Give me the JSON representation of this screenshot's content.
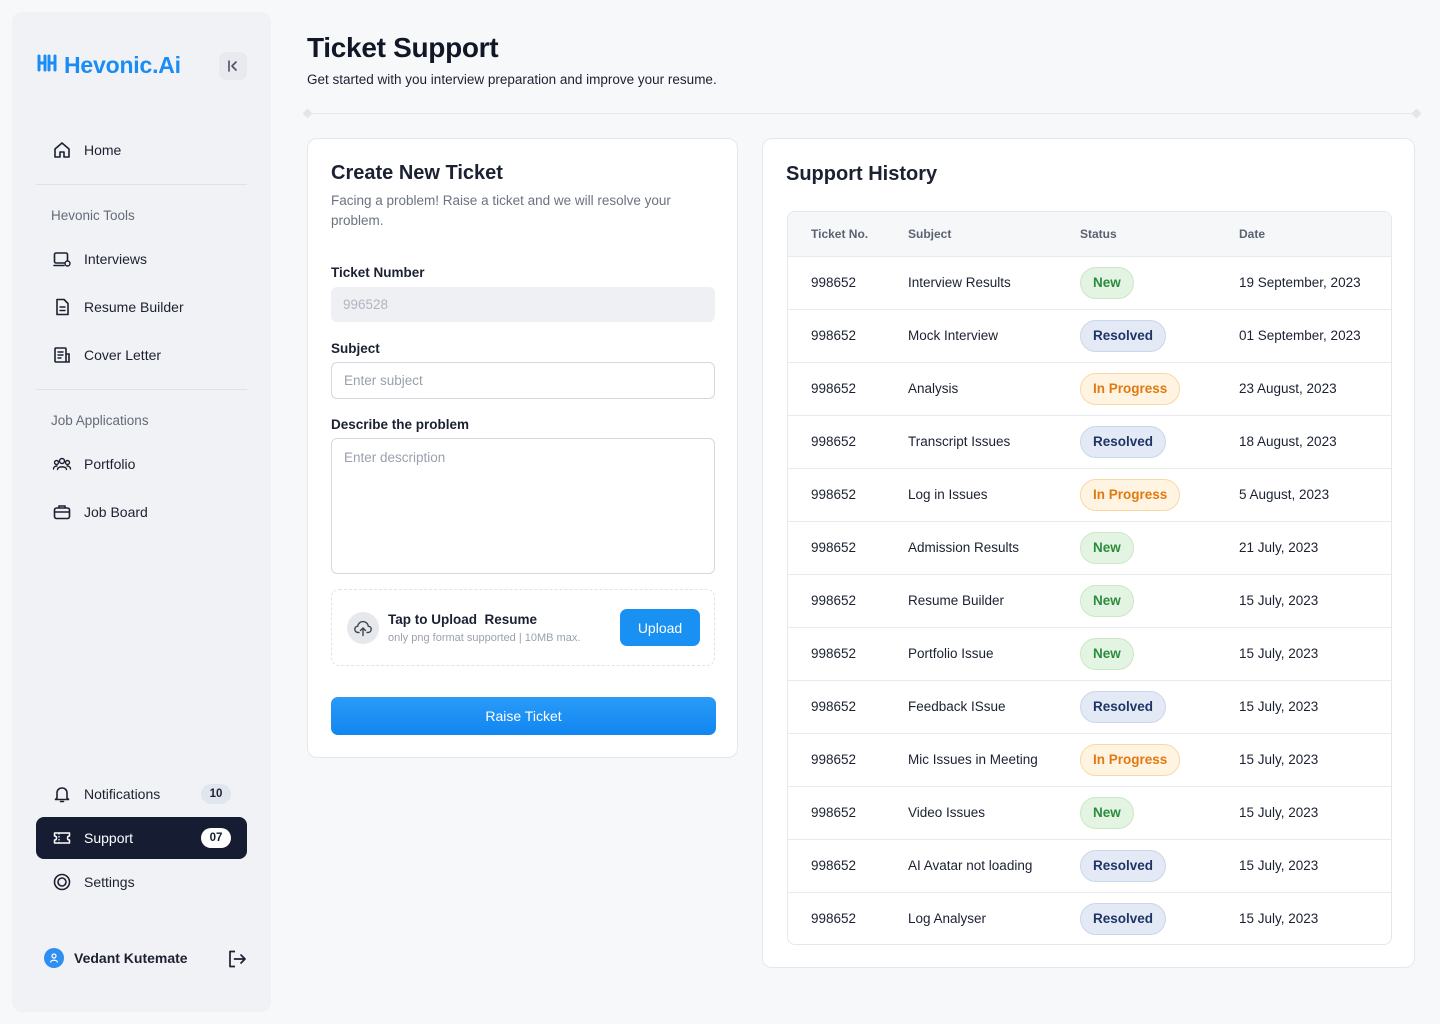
{
  "brand": {
    "name": "Hevonic.Ai",
    "color": "#1a8cf5"
  },
  "sidebar": {
    "home": "Home",
    "tools_label": "Hevonic Tools",
    "tools": [
      "Interviews",
      "Resume Builder",
      "Cover Letter"
    ],
    "jobs_label": "Job Applications",
    "jobs": [
      "Portfolio",
      "Job Board"
    ],
    "notifications": {
      "label": "Notifications",
      "count": "10"
    },
    "support": {
      "label": "Support",
      "count": "07"
    },
    "settings": "Settings",
    "user_name": "Vedant Kutemate"
  },
  "header": {
    "title": "Ticket Support",
    "subtitle": "Get started with you interview preparation and improve your resume."
  },
  "create_ticket": {
    "title": "Create New Ticket",
    "description": "Facing a problem! Raise a ticket and we will resolve your problem.",
    "ticket_number_label": "Ticket Number",
    "ticket_number_value": "996528",
    "subject_label": "Subject",
    "subject_placeholder": "Enter subject",
    "description_label": "Describe the problem",
    "description_placeholder": "Enter description",
    "upload_title": "Tap to Upload  Resume",
    "upload_hint": "only png format supported | 10MB max.",
    "upload_button": "Upload",
    "submit_button": "Raise Ticket"
  },
  "history": {
    "title": "Support History",
    "columns": [
      "Ticket No.",
      "Subject",
      "Status",
      "Date"
    ],
    "rows": [
      {
        "ticket": "998652",
        "subject": "Interview Results",
        "status": "New",
        "date": "19 September, 2023"
      },
      {
        "ticket": "998652",
        "subject": "Mock Interview",
        "status": "Resolved",
        "date": "01 September, 2023"
      },
      {
        "ticket": "998652",
        "subject": "Analysis",
        "status": "In Progress",
        "date": "23 August, 2023"
      },
      {
        "ticket": "998652",
        "subject": "Transcript Issues",
        "status": "Resolved",
        "date": "18 August, 2023"
      },
      {
        "ticket": "998652",
        "subject": "Log in Issues",
        "status": "In Progress",
        "date": "5 August, 2023"
      },
      {
        "ticket": "998652",
        "subject": "Admission Results",
        "status": "New",
        "date": "21 July, 2023"
      },
      {
        "ticket": "998652",
        "subject": "Resume Builder",
        "status": "New",
        "date": "15 July, 2023"
      },
      {
        "ticket": "998652",
        "subject": "Portfolio Issue",
        "status": "New",
        "date": "15 July, 2023"
      },
      {
        "ticket": "998652",
        "subject": "Feedback ISsue",
        "status": "Resolved",
        "date": "15 July, 2023"
      },
      {
        "ticket": "998652",
        "subject": "Mic Issues in Meeting",
        "status": "In Progress",
        "date": "15 July, 2023"
      },
      {
        "ticket": "998652",
        "subject": "Video Issues",
        "status": "New",
        "date": "15 July, 2023"
      },
      {
        "ticket": "998652",
        "subject": "AI Avatar not loading",
        "status": "Resolved",
        "date": "15 July, 2023"
      },
      {
        "ticket": "998652",
        "subject": "Log Analyser",
        "status": "Resolved",
        "date": "15 July, 2023"
      }
    ]
  },
  "icons": [
    "logo-icon",
    "collapse-icon",
    "home-icon",
    "interviews-icon",
    "resume-icon",
    "cover-letter-icon",
    "portfolio-icon",
    "job-board-icon",
    "bell-icon",
    "ticket-icon",
    "settings-icon",
    "user-icon",
    "logout-icon",
    "cloud-upload-icon"
  ]
}
